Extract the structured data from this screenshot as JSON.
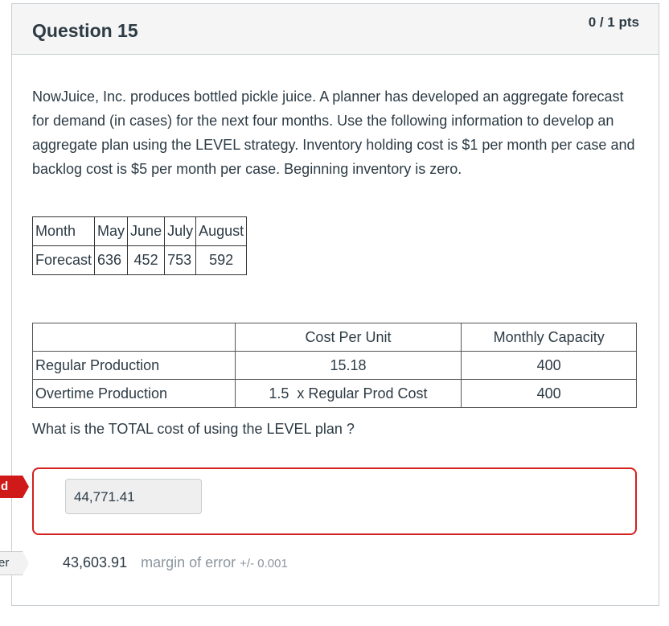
{
  "question": {
    "title": "Question 15",
    "points": "0 / 1 pts",
    "text": "NowJuice, Inc. produces bottled pickle juice.  A planner has developed an aggregate forecast for demand (in cases) for the next four months.  Use the following information to develop an aggregate plan using the LEVEL strategy.  Inventory holding cost is $1 per month per case and backlog cost is $5 per month per case.  Beginning inventory is zero.",
    "forecast_table": {
      "header": [
        "Month",
        "May",
        "June",
        "July",
        "August"
      ],
      "row": [
        "Forecast",
        "636",
        "452",
        "753",
        "592"
      ]
    },
    "cost_table": {
      "header": [
        "",
        "Cost Per Unit",
        "Monthly Capacity"
      ],
      "rows": [
        [
          "Regular Production",
          "15.18",
          "400"
        ],
        [
          "Overtime Production",
          "1.5  x Regular Prod Cost",
          "400"
        ]
      ]
    },
    "prompt": "What is the TOTAL cost of using the LEVEL plan ?",
    "your_answer": "44,771.41",
    "correct_answer": "43,603.91",
    "margin_text": "margin of error",
    "margin_value": "+/- 0.001",
    "flags": {
      "you_answered": "d",
      "correct_answer": "er"
    },
    "colors": {
      "incorrect": "#d41f1f",
      "muted": "#8b969e"
    }
  }
}
